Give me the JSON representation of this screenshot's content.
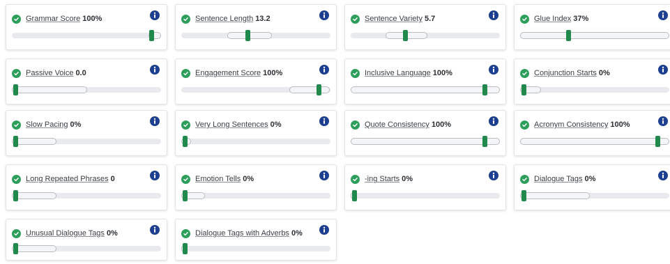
{
  "colors": {
    "check": "#2e9e5b",
    "thumb": "#1f8a4c",
    "info": "#1c3f8f",
    "track": "#e8eaee"
  },
  "icons": {
    "status": "check-circle-icon",
    "help": "info-icon"
  },
  "metrics": [
    {
      "label": "Grammar Score",
      "value": "100%",
      "level": 1.0
    },
    {
      "label": "Sentence Length",
      "value": "13.2",
      "level": 0.5
    },
    {
      "label": "Sentence Variety",
      "value": "5.7",
      "level": 0.39
    },
    {
      "label": "Glue Index",
      "value": "37%",
      "level": 0.37
    },
    {
      "label": "Passive Voice",
      "value": "0.0",
      "level": 0.0
    },
    {
      "label": "Engagement Score",
      "value": "100%",
      "level": 0.92
    },
    {
      "label": "Inclusive Language",
      "value": "100%",
      "level": 0.92
    },
    {
      "label": "Conjunction Starts",
      "value": "0%",
      "level": 0.0
    },
    {
      "label": "Slow Pacing",
      "value": "0%",
      "level": 0.0
    },
    {
      "label": "Very Long Sentences",
      "value": "0%",
      "level": 0.0
    },
    {
      "label": "Quote Consistency",
      "value": "100%",
      "level": 0.92
    },
    {
      "label": "Acronym Consistency",
      "value": "100%",
      "level": 0.92
    },
    {
      "label": "Long Repeated Phrases",
      "value": "0",
      "level": 0.0
    },
    {
      "label": "Emotion Tells",
      "value": "0%",
      "level": 0.0
    },
    {
      "label": "-ing Starts",
      "value": "0%",
      "level": 0.0
    },
    {
      "label": "Dialogue Tags",
      "value": "0%",
      "level": 0.0
    },
    {
      "label": "Unusual Dialogue Tags",
      "value": "0%",
      "level": 0.0
    },
    {
      "label": "Dialogue Tags with Adverbs",
      "value": "0%",
      "level": 0.0
    }
  ]
}
